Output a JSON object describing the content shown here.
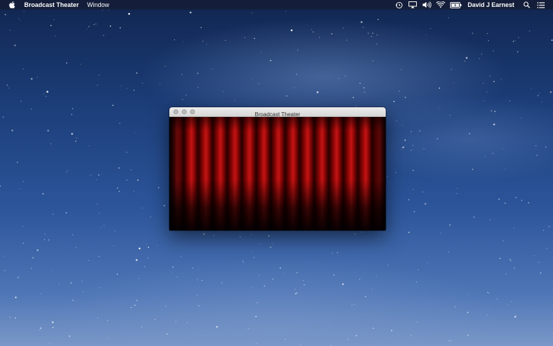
{
  "menubar": {
    "apple_icon": "apple-icon",
    "app_name": "Broadcast Theater",
    "menus": [
      "Window"
    ],
    "status_icons": [
      "time-machine-icon",
      "airplay-icon",
      "volume-icon",
      "wifi-icon",
      "battery-icon"
    ],
    "user_name": "David J Earnest",
    "search_icon": "spotlight-search-icon",
    "notification_icon": "notification-center-icon"
  },
  "window": {
    "title": "Broadcast Theater",
    "buttons": [
      "close",
      "minimize",
      "zoom"
    ],
    "content": "red-stage-curtain"
  },
  "colors": {
    "menubar_bg": "#141e37",
    "titlebar_bg": "#e3e3e3",
    "curtain_red": "#c41414",
    "sky_top": "#102650",
    "sky_bottom": "#7a98c8"
  }
}
